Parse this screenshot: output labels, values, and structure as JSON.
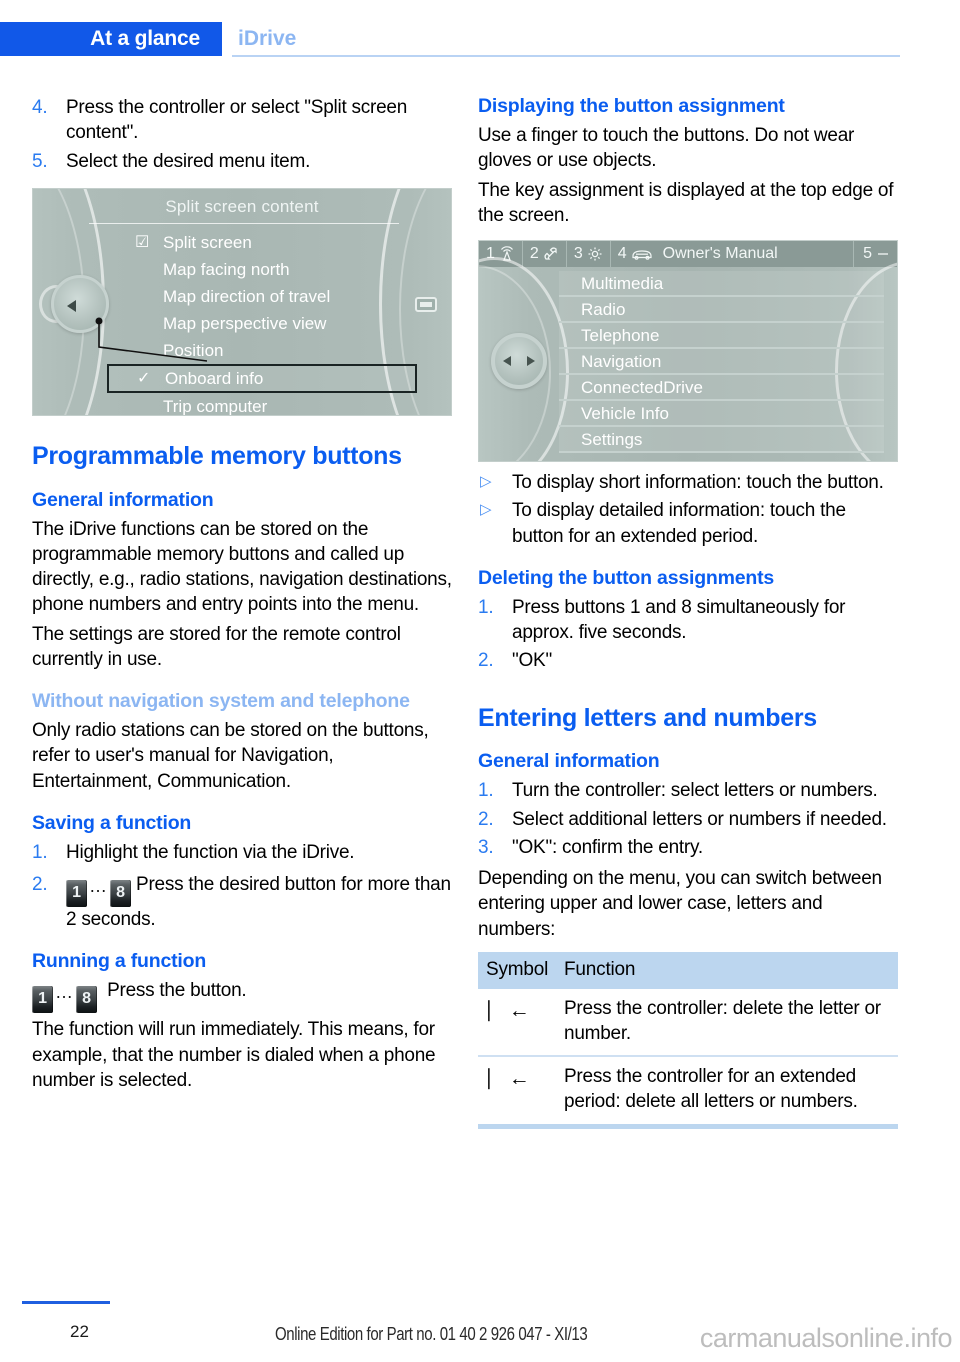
{
  "header": {
    "chapter": "At a glance",
    "section": "iDrive"
  },
  "colors": {
    "accent_blue": "#0a5df0",
    "tab_blue": "#1158e8",
    "light_blue": "#8cb6f2",
    "table_header": "#bcd6ef",
    "screen_bg": "#a9b7b3"
  },
  "left_column": {
    "continued_steps": [
      {
        "num": "4.",
        "text": "Press the controller or select \"Split screen content\"."
      },
      {
        "num": "5.",
        "text": "Select the desired menu item."
      }
    ],
    "screenshot": {
      "title": "Split screen content",
      "items": [
        {
          "label": "Split screen",
          "mark": "checkbox-empty-icon",
          "mark_glyph": "☑",
          "selected": false
        },
        {
          "label": "Map facing north",
          "mark": "",
          "mark_glyph": "",
          "selected": false
        },
        {
          "label": "Map direction of travel",
          "mark": "",
          "mark_glyph": "",
          "selected": false
        },
        {
          "label": "Map perspective view",
          "mark": "",
          "mark_glyph": "",
          "selected": false
        },
        {
          "label": "Position",
          "mark": "",
          "mark_glyph": "",
          "selected": false
        },
        {
          "label": "Onboard info",
          "mark": "check-icon",
          "mark_glyph": "✓",
          "selected": true
        },
        {
          "label": "Trip computer",
          "mark": "",
          "mark_glyph": "",
          "selected": false
        }
      ]
    },
    "h1_programmable": "Programmable memory buttons",
    "h2_general_information": "General information",
    "p_general_1": "The iDrive functions can be stored on the programmable memory buttons and called up directly, e.g., radio stations, navigation destinations, phone numbers and entry points into the menu.",
    "p_general_2": "The settings are stored for the remote control currently in use.",
    "h2_without_nav": "Without navigation system and telephone",
    "p_without_nav": "Only radio stations can be stored on the buttons, refer to user's manual for Navigation, Entertainment, Communication.",
    "h2_saving": "Saving a function",
    "saving_steps": [
      {
        "num": "1.",
        "text": "Highlight the function via the iDrive."
      },
      {
        "num": "2.",
        "text": "Press the desired button for more than 2 seconds."
      }
    ],
    "h2_running": "Running a function",
    "running_text_1": "Press the button.",
    "running_text_2": "The function will run immediately. This means, for example, that the number is dialed when a phone number is selected.",
    "key_first": "1",
    "key_last": "8",
    "key_dots": "…"
  },
  "right_column": {
    "h2_displaying": "Displaying the button assignment",
    "p_displaying_1": "Use a finger to touch the buttons. Do not wear gloves or use objects.",
    "p_displaying_2": "The key assignment is displayed at the top edge of the screen.",
    "screenshot": {
      "topbar": [
        {
          "num": "1",
          "icon": "broadcast-antenna-icon",
          "label": ""
        },
        {
          "num": "2",
          "icon": "phone-handset-icon",
          "label": ""
        },
        {
          "num": "3",
          "icon": "gear-icon",
          "label": ""
        },
        {
          "num": "4",
          "icon": "car-icon",
          "label": "Owner's Manual"
        },
        {
          "num": "5",
          "icon": "dash-icon",
          "label": ""
        }
      ],
      "menu_items": [
        "Multimedia",
        "Radio",
        "Telephone",
        "Navigation",
        "ConnectedDrive",
        "Vehicle Info",
        "Settings"
      ]
    },
    "bullets": [
      {
        "glyph": "▷",
        "text": "To display short information: touch the button."
      },
      {
        "glyph": "▷",
        "text": "To display detailed information: touch the button for an extended period."
      }
    ],
    "h2_deleting": "Deleting the button assignments",
    "deleting_steps": [
      {
        "num": "1.",
        "text": "Press buttons 1 and 8 simultaneously for approx. five seconds."
      },
      {
        "num": "2.",
        "text": "\"OK\""
      }
    ],
    "h1_entering": "Entering letters and numbers",
    "h2_general_information": "General information",
    "entering_steps": [
      {
        "num": "1.",
        "text": "Turn the controller: select letters or numbers."
      },
      {
        "num": "2.",
        "text": "Select additional letters or numbers if needed."
      },
      {
        "num": "3.",
        "text": "\"OK\": confirm the entry."
      }
    ],
    "p_depending": "Depending on the menu, you can switch between entering upper and lower case, letters and numbers:",
    "table": {
      "headers": [
        "Symbol",
        "Function"
      ],
      "rows": [
        {
          "symbol": "⎸←",
          "symbol_name": "backspace-icon",
          "function": "Press the controller: delete the letter or number."
        },
        {
          "symbol": "⎸←",
          "symbol_name": "backspace-icon",
          "function": "Press the controller for an extended period: delete all letters or numbers."
        }
      ]
    }
  },
  "footer": {
    "page_number": "22",
    "edition": "Online Edition for Part no. 01 40 2 926 047 - XI/13",
    "watermark": "carmanualsonline.info"
  }
}
